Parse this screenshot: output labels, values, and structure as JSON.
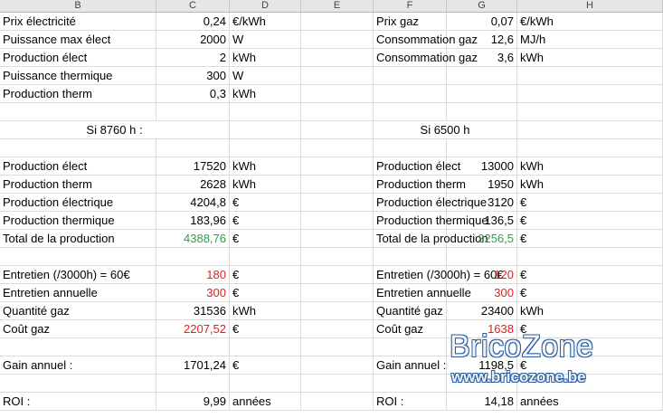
{
  "columns": [
    "B",
    "C",
    "D",
    "E",
    "F",
    "G",
    "H"
  ],
  "colors": {
    "green": "#2e9e49",
    "red": "#e02020",
    "header_bg": "#e6e6e6",
    "grid": "#dcdcdc",
    "watermark": "#2d5f9e"
  },
  "rows": [
    [
      "Prix électricité",
      "0,24",
      "€/kWh",
      "",
      "Prix gaz",
      "0,07",
      "€/kWh"
    ],
    [
      "Puissance max élect",
      "2000",
      "W",
      "",
      "Consommation gaz",
      "12,6",
      "MJ/h"
    ],
    [
      "Production élect",
      "2",
      "kWh",
      "",
      "Consommation gaz",
      "3,6",
      "kWh"
    ],
    [
      "Puissance thermique",
      "300",
      "W",
      "",
      "",
      "",
      ""
    ],
    [
      "Production therm",
      "0,3",
      "kWh",
      "",
      "",
      "",
      ""
    ],
    [
      "",
      "",
      "",
      "",
      "",
      "",
      ""
    ],
    [
      "Si 8760 h :",
      "",
      "",
      "",
      "Si 6500 h",
      "",
      ""
    ],
    [
      "",
      "",
      "",
      "",
      "",
      "",
      ""
    ],
    [
      "Production élect",
      "17520",
      "kWh",
      "",
      "Production élect",
      "13000",
      "kWh"
    ],
    [
      "Production therm",
      "2628",
      "kWh",
      "",
      "Production therm",
      "1950",
      "kWh"
    ],
    [
      "Production électrique",
      "4204,8",
      "€",
      "",
      "Production électrique",
      "3120",
      "€"
    ],
    [
      "Production thermique",
      "183,96",
      "€",
      "",
      "Production thermique",
      "136,5",
      "€"
    ],
    [
      "Total de la production",
      "4388,76",
      "€",
      "",
      "Total de la production",
      "3256,5",
      "€"
    ],
    [
      "",
      "",
      "",
      "",
      "",
      "",
      ""
    ],
    [
      "Entretien (/3000h) = 60€",
      "180",
      "€",
      "",
      "Entretien (/3000h) = 60€",
      "120",
      "€"
    ],
    [
      "Entretien annuelle",
      "300",
      "€",
      "",
      "Entretien annuelle",
      "300",
      "€"
    ],
    [
      "Quantité gaz",
      "31536",
      "kWh",
      "",
      "Quantité gaz",
      "23400",
      "kWh"
    ],
    [
      "Coût gaz",
      "2207,52",
      "€",
      "",
      "Coût gaz",
      "1638",
      "€"
    ],
    [
      "",
      "",
      "",
      "",
      "",
      "",
      ""
    ],
    [
      "Gain annuel :",
      "1701,24",
      "€",
      "",
      "Gain annuel :",
      "1198,5",
      "€"
    ],
    [
      "",
      "",
      "",
      "",
      "",
      "",
      ""
    ],
    [
      "ROI :",
      "9,99",
      "années",
      "",
      "ROI :",
      "14,18",
      "années"
    ]
  ],
  "watermark": {
    "logo": "BricoZone",
    "url": "www.bricozone.be"
  }
}
